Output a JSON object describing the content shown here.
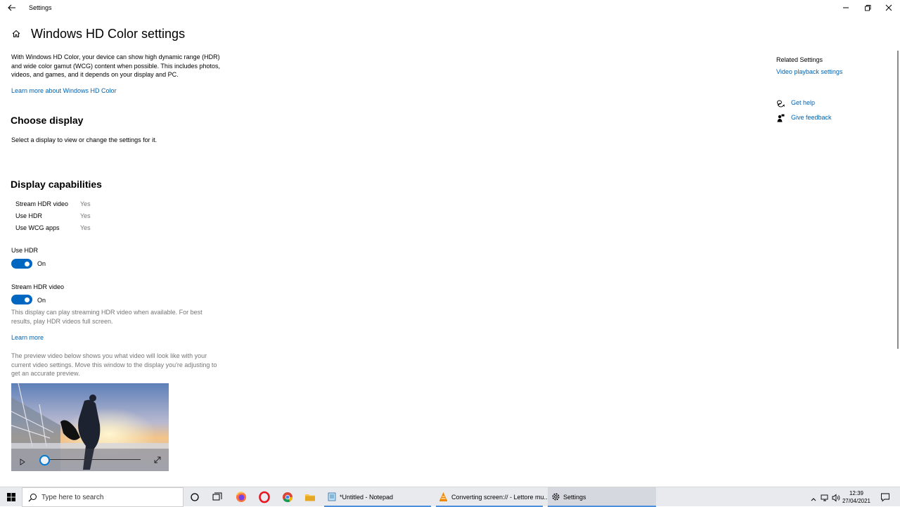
{
  "window": {
    "title": "Settings"
  },
  "page": {
    "title": "Windows HD Color settings",
    "intro": "With Windows HD Color, your device can show high dynamic range (HDR) and wide color gamut (WCG) content when possible. This includes photos, videos, and games, and it depends on your display and PC.",
    "learn_more_hd": "Learn more about Windows HD Color"
  },
  "choose_display": {
    "heading": "Choose display",
    "description": "Select a display to view or change the settings for it."
  },
  "capabilities": {
    "heading": "Display capabilities",
    "rows": [
      {
        "label": "Stream HDR video",
        "value": "Yes"
      },
      {
        "label": "Use HDR",
        "value": "Yes"
      },
      {
        "label": "Use WCG apps",
        "value": "Yes"
      }
    ]
  },
  "use_hdr": {
    "label": "Use HDR",
    "state": "On"
  },
  "stream_hdr": {
    "label": "Stream HDR video",
    "state": "On",
    "description": "This display can play streaming HDR video when available. For best results, play HDR videos full screen.",
    "learn_more": "Learn more",
    "preview_note": "The preview video below shows you what video will look like with your current video settings. Move this window to the display you're adjusting to get an accurate preview."
  },
  "related": {
    "heading": "Related Settings",
    "video_playback": "Video playback settings",
    "get_help": "Get help",
    "give_feedback": "Give feedback"
  },
  "taskbar": {
    "search_placeholder": "Type here to search",
    "tasks": [
      {
        "label": "*Untitled - Notepad",
        "icon": "notepad-icon"
      },
      {
        "label": "Converting screen:// - Lettore mu...",
        "icon": "vlc-icon"
      },
      {
        "label": "Settings",
        "icon": "gear-icon"
      }
    ],
    "time": "12:39",
    "date": "27/04/2021"
  },
  "colors": {
    "accent": "#0067c0",
    "link": "#0063b1",
    "muted": "#767676"
  }
}
